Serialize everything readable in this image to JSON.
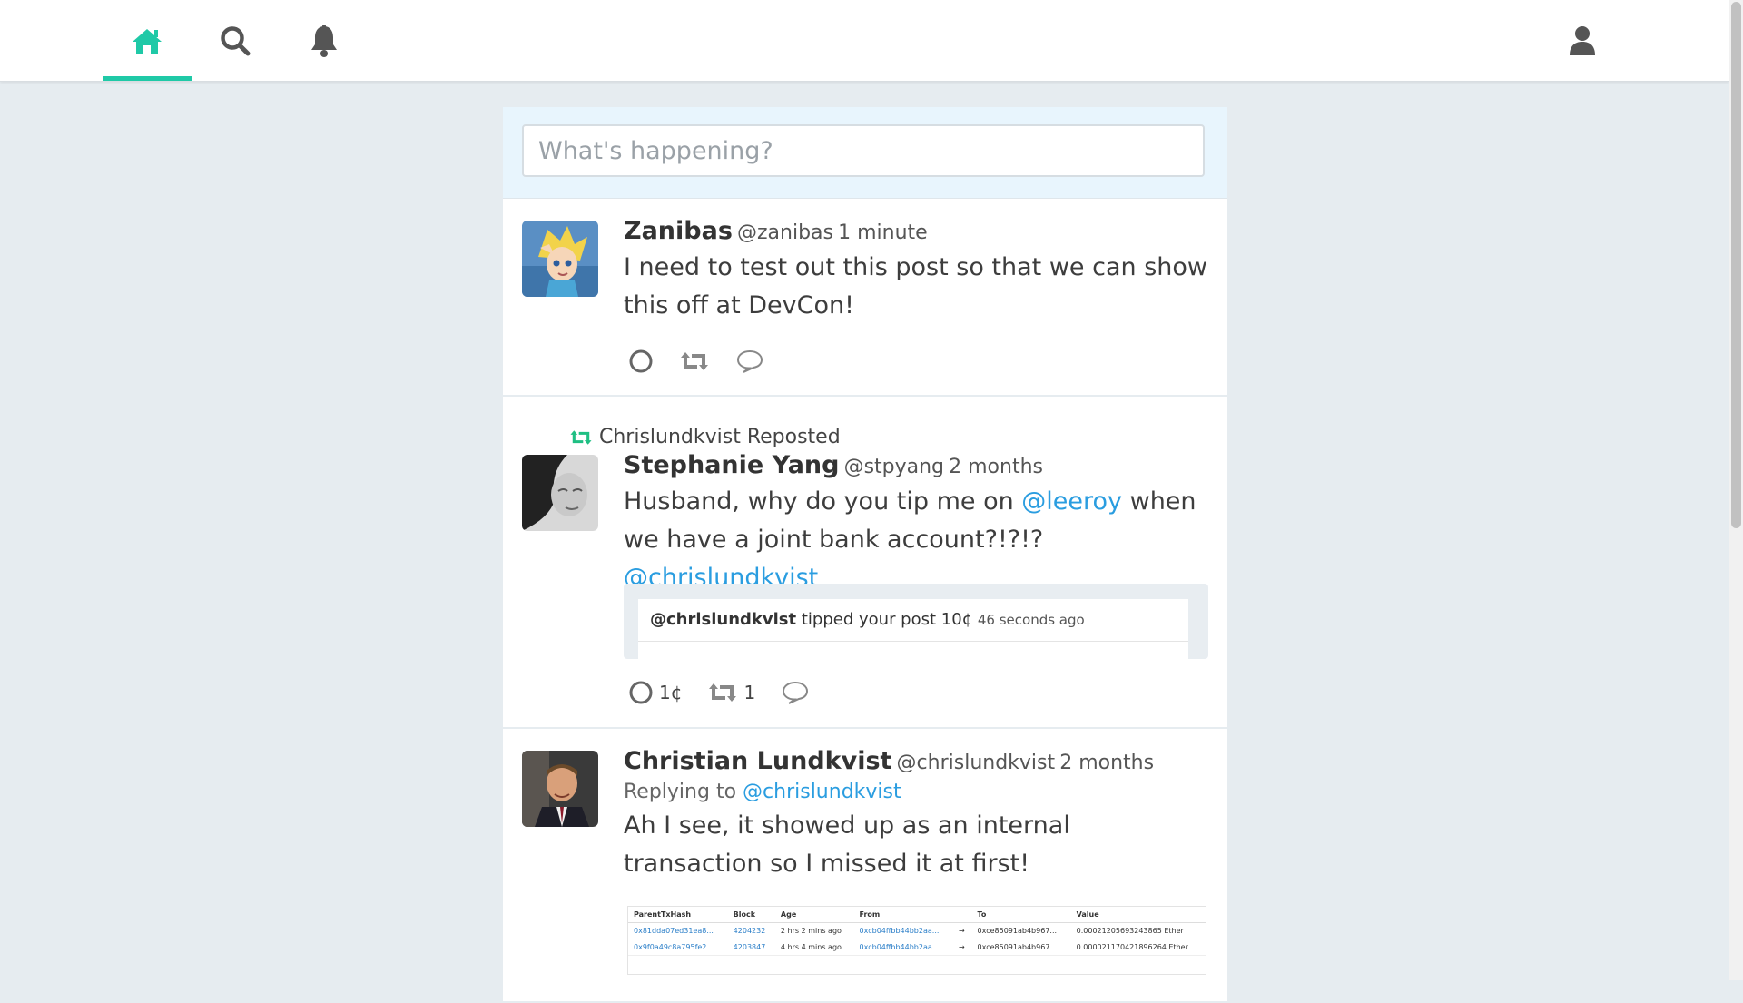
{
  "nav": {
    "tabs": [
      {
        "name": "home",
        "icon": "home-icon",
        "active": true
      },
      {
        "name": "search",
        "icon": "search-icon",
        "active": false
      },
      {
        "name": "notifications",
        "icon": "bell-icon",
        "active": false
      }
    ],
    "profile_icon": "user-icon",
    "accent_color": "#1fc9a7"
  },
  "compose": {
    "placeholder": "What's happening?"
  },
  "posts": [
    {
      "name": "Zanibas",
      "handle": "@zanibas",
      "time": "1 minute",
      "text": "I need to test out this post so that we can show this off at DevCon!"
    },
    {
      "repost_by": "Chrislundkvist Reposted",
      "name": "Stephanie Yang",
      "handle": "@stpyang",
      "time": "2 months",
      "text_parts": [
        "Husband, why do you tip me on ",
        "@leeroy",
        " when we have a joint bank account?!?!? ",
        "@chrislundkvist"
      ],
      "tip": {
        "user": "@chrislundkvist",
        "action": "tipped your post 10¢",
        "time": "46 seconds ago"
      },
      "tip_amount": "1¢",
      "repost_count": "1"
    },
    {
      "name": "Christian Lundkvist",
      "handle": "@chrislundkvist",
      "time": "2 months",
      "replying_label": "Replying to",
      "replying_to": "@chrislundkvist",
      "text": "Ah I see, it showed up as an internal transaction so I missed it at first!",
      "table": {
        "headers": [
          "ParentTxHash",
          "Block",
          "Age",
          "From",
          "",
          "To",
          "Value"
        ],
        "rows": [
          [
            "0x81dda07ed31ea8...",
            "4204232",
            "2 hrs 2 mins ago",
            "0xcb04ffbb44bb2aa...",
            "→",
            "0xce85091ab4b967...",
            "0.00021205693243865 Ether"
          ],
          [
            "0x9f0a49c8a795fe2...",
            "4203847",
            "4 hrs 4 mins ago",
            "0xcb04ffbb44bb2aa...",
            "→",
            "0xce85091ab4b967...",
            "0.000021170421896264 Ether"
          ]
        ]
      }
    }
  ]
}
